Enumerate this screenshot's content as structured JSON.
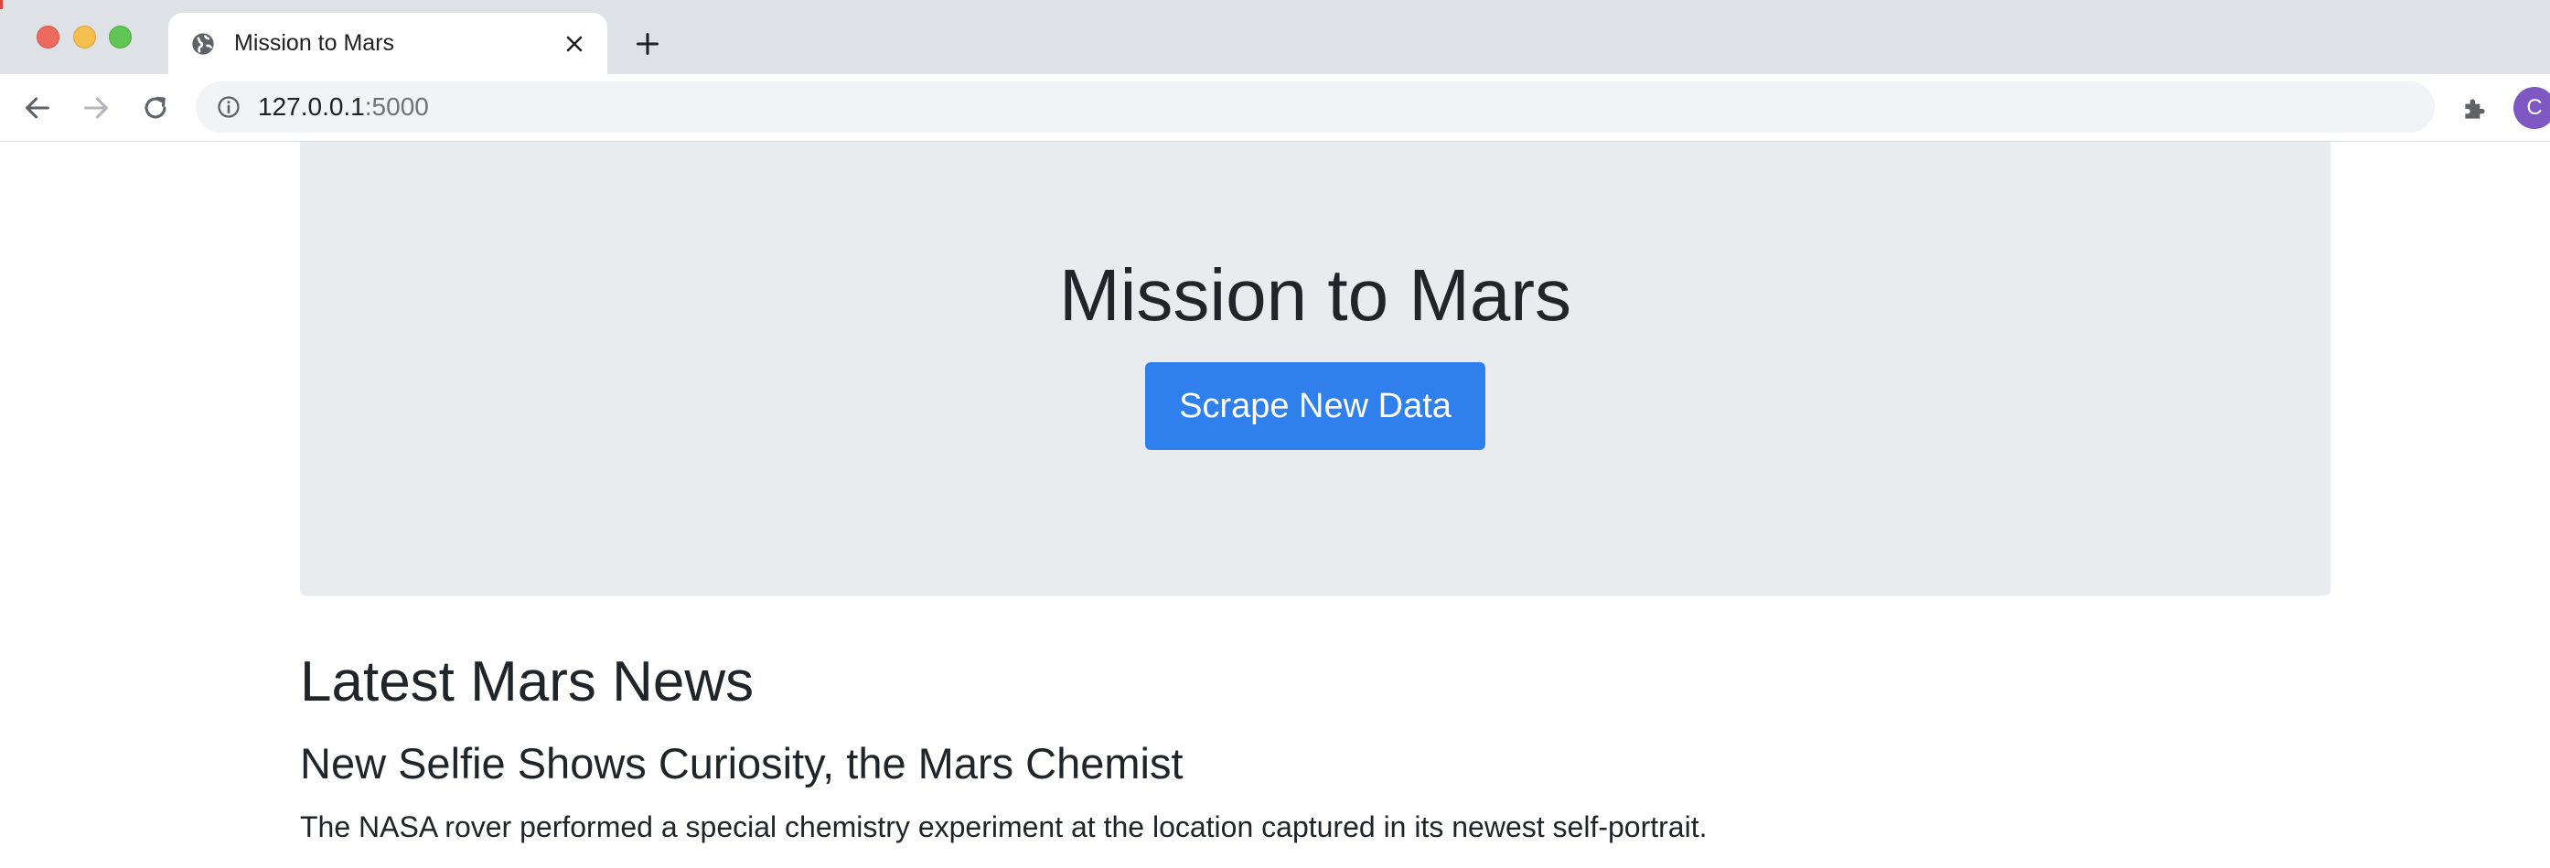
{
  "browser": {
    "tab": {
      "title": "Mission to Mars"
    },
    "address_bar": {
      "host": "127.0.0.1",
      "port": ":5000"
    },
    "profile_initial": "C"
  },
  "jumbotron": {
    "title": "Mission to Mars",
    "button_label": "Scrape New Data"
  },
  "news": {
    "section_heading": "Latest Mars News",
    "article_title": "New Selfie Shows Curiosity, the Mars Chemist",
    "article_teaser": "The NASA rover performed a special chemistry experiment at the location captured in its newest self-portrait."
  },
  "colors": {
    "accent_button": "#2f80ed",
    "jumbotron_bg": "#e9ecef",
    "tabstrip_bg": "#dee1e6",
    "avatar_bg": "#7e57c2"
  }
}
